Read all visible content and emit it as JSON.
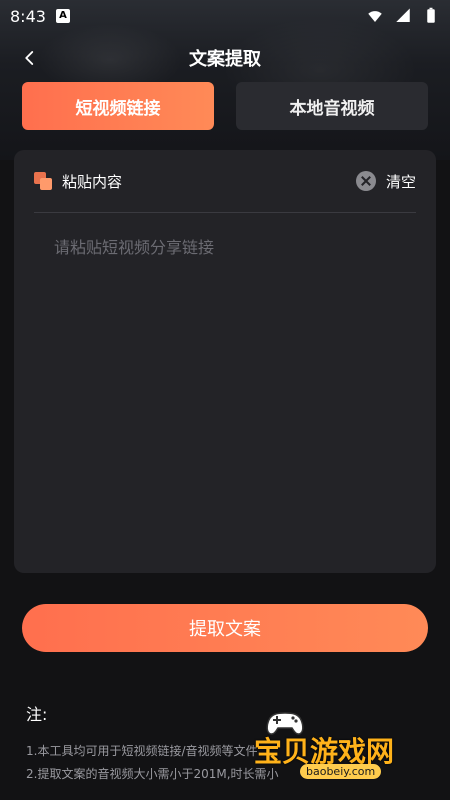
{
  "status": {
    "time": "8:43",
    "badge": "A"
  },
  "header": {
    "title": "文案提取"
  },
  "tabs": [
    {
      "label": "短视频链接",
      "active": true
    },
    {
      "label": "本地音视频",
      "active": false
    }
  ],
  "card": {
    "paste_label": "粘贴内容",
    "clear_label": "清空",
    "placeholder": "请粘贴短视频分享链接"
  },
  "extract_button": {
    "label": "提取文案"
  },
  "notes": {
    "title": "注:",
    "line1": "1.本工具均可用于短视频链接/音视频等文件",
    "line2": "2.提取文案的音视频大小需小于201M,时长需小"
  },
  "watermark": {
    "text": "宝贝游戏网",
    "site": "baobeiy.com"
  },
  "colors": {
    "accent_start": "#ff6f4e",
    "accent_end": "#ff8a57",
    "background": "#121214"
  },
  "icons": [
    "back-icon",
    "wifi-icon",
    "signal-icon",
    "battery-icon",
    "paste-icon",
    "clear-icon",
    "gamepad-icon"
  ]
}
